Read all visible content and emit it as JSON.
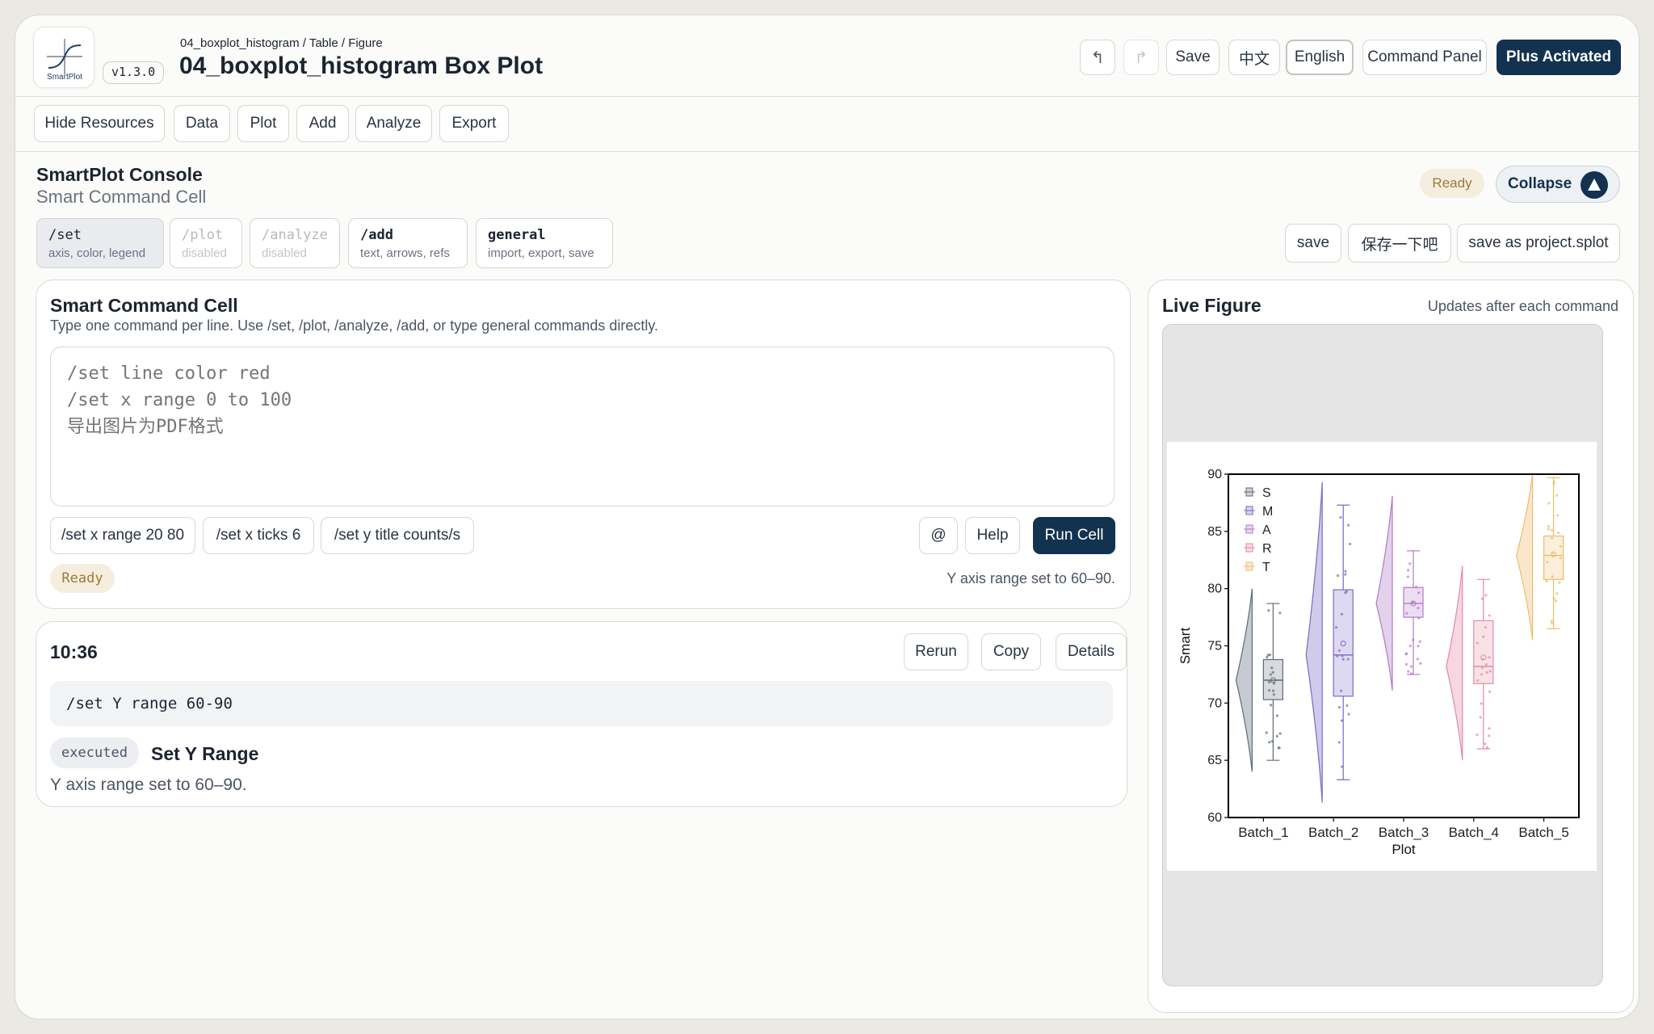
{
  "header": {
    "logo_text": "SmartPlot",
    "version": "v1.3.0",
    "breadcrumb": "04_boxplot_histogram / Table / Figure",
    "title": "04_boxplot_histogram Box Plot",
    "buttons": {
      "save": "Save",
      "chinese": "中文",
      "english": "English",
      "command_panel": "Command Panel",
      "plus": "Plus Activated"
    }
  },
  "toolbar": {
    "hide_resources": "Hide Resources",
    "data": "Data",
    "plot": "Plot",
    "add": "Add",
    "analyze": "Analyze",
    "export": "Export"
  },
  "console": {
    "title": "SmartPlot Console",
    "subtitle": "Smart Command Cell",
    "status": "Ready",
    "collapse": "Collapse",
    "chips": [
      {
        "cmd": "/set",
        "desc": "axis, color, legend"
      },
      {
        "cmd": "/plot",
        "desc": "disabled"
      },
      {
        "cmd": "/analyze",
        "desc": "disabled"
      },
      {
        "cmd": "/add",
        "desc": "text, arrows, refs"
      },
      {
        "cmd": "general",
        "desc": "import, export, save"
      }
    ],
    "quick_save": [
      "save",
      "保存一下吧",
      "save as project.splot"
    ]
  },
  "cell": {
    "title": "Smart Command Cell",
    "hint": "Type one command per line. Use /set, /plot, /analyze, /add, or type general commands directly.",
    "placeholder": "/set line color red\n/set x range 0 to 100\n导出图片为PDF格式",
    "suggestions": [
      "/set x range 20 80",
      "/set x ticks 6",
      "/set y title counts/s"
    ],
    "at": "@",
    "help": "Help",
    "run": "Run Cell",
    "status": "Ready",
    "result": "Y axis range set to 60–90."
  },
  "history": {
    "time": "10:36",
    "rerun": "Rerun",
    "copy": "Copy",
    "details": "Details",
    "command": "/set Y range 60-90",
    "badge": "executed",
    "action": "Set Y Range",
    "message": "Y axis range set to 60–90."
  },
  "figure_panel": {
    "title": "Live Figure",
    "note": "Updates after each command"
  },
  "chart_data": {
    "type": "box",
    "categories": [
      "Batch_1",
      "Batch_2",
      "Batch_3",
      "Batch_4",
      "Batch_5"
    ],
    "xlabel": "Plot",
    "ylabel": "Smart",
    "ylim": [
      60,
      90
    ],
    "yticks": [
      60,
      65,
      70,
      75,
      80,
      85,
      90
    ],
    "legend": [
      "S",
      "M",
      "A",
      "R",
      "T"
    ],
    "legend_position": "top-left",
    "colors": [
      "#5f6b7a",
      "#7c68c4",
      "#b27ac8",
      "#e58aa2",
      "#f0bb6a"
    ],
    "boxes": [
      {
        "whisker_low": 65,
        "q1": 70.3,
        "median": 72,
        "q3": 73.8,
        "whisker_high": 78.7,
        "mean": 72
      },
      {
        "whisker_low": 63.3,
        "q1": 70.6,
        "median": 74.2,
        "q3": 79.9,
        "whisker_high": 87.3,
        "mean": 75.2
      },
      {
        "whisker_low": 72.5,
        "q1": 77.5,
        "median": 78.7,
        "q3": 80.1,
        "whisker_high": 83.3,
        "mean": 78.7
      },
      {
        "whisker_low": 66,
        "q1": 71.7,
        "median": 73.2,
        "q3": 77.2,
        "whisker_high": 80.8,
        "mean": 74
      },
      {
        "whisker_low": 76.5,
        "q1": 80.8,
        "median": 82.9,
        "q3": 84.6,
        "whisker_high": 89.7,
        "mean": 83
      }
    ],
    "violin_range": [
      [
        64,
        80
      ],
      [
        61.3,
        89.3
      ],
      [
        71.1,
        88.1
      ],
      [
        65,
        82
      ],
      [
        75.5,
        90
      ]
    ]
  }
}
